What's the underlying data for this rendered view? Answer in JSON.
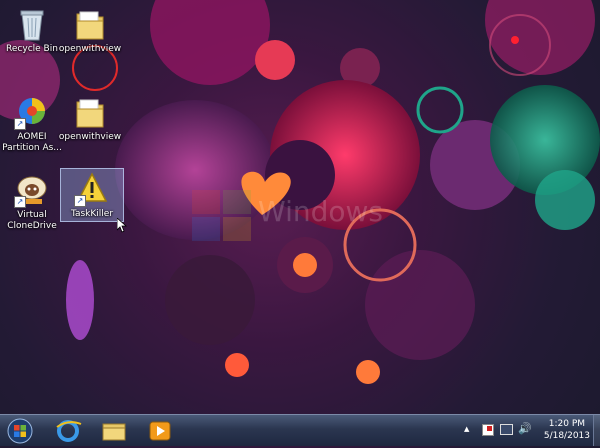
{
  "desktop": {
    "icons": [
      {
        "label": "Recycle Bin"
      },
      {
        "label": "openwithview"
      },
      {
        "label": "AOMEI Partition As..."
      },
      {
        "label": "openwithview"
      },
      {
        "label": "Virtual CloneDrive"
      },
      {
        "label": "TaskKiller"
      }
    ],
    "watermark": "Windows"
  },
  "taskbar": {
    "start_button": "start-orb-icon",
    "pinned": [
      "internet-explorer-icon",
      "explorer-folder-icon",
      "media-player-icon"
    ],
    "tray": {
      "show_hidden": "▲",
      "time": "1:20 PM",
      "date": "5/18/2013"
    }
  },
  "colors": {
    "accent_red": "#e0203a",
    "magenta": "#c2187a",
    "teal": "#1fa58a",
    "taskbar": "#2b3650"
  }
}
